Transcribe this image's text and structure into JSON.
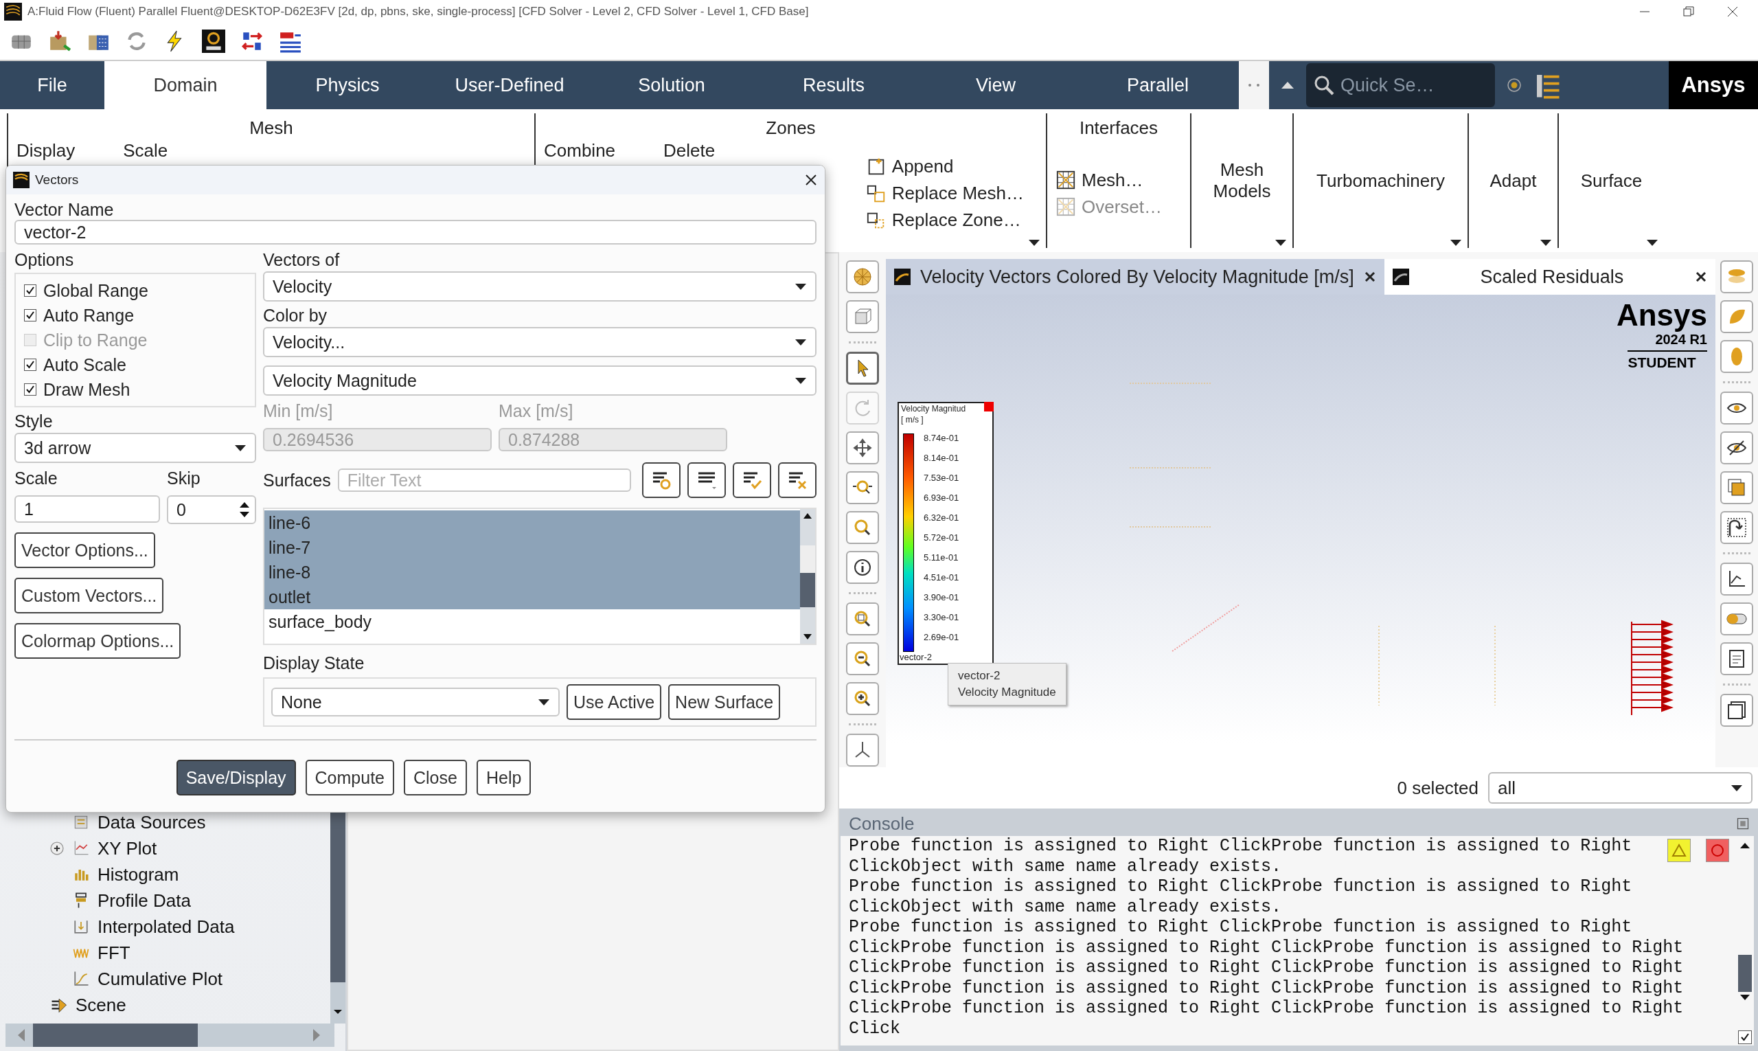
{
  "window": {
    "title": "A:Fluid Flow (Fluent) Parallel Fluent@DESKTOP-D62E3FV  [2d, dp, pbns, ske, single-process] [CFD Solver - Level 2, CFD Solver - Level 1, CFD Base]"
  },
  "menu_tabs": [
    {
      "label": "File",
      "selected": false
    },
    {
      "label": "Domain",
      "selected": true
    },
    {
      "label": "Physics",
      "selected": false
    },
    {
      "label": "User-Defined",
      "selected": false
    },
    {
      "label": "Solution",
      "selected": false
    },
    {
      "label": "Results",
      "selected": false
    },
    {
      "label": "View",
      "selected": false
    },
    {
      "label": "Parallel",
      "selected": false
    }
  ],
  "search": {
    "placeholder": "Quick Se…"
  },
  "brand": "Ansys",
  "ribbon": [
    {
      "kind": "buttons",
      "title": "Mesh",
      "buttons": [
        {
          "label": "Display"
        },
        {
          "label": "Scale"
        }
      ]
    },
    {
      "kind": "buttons",
      "title": "Zones",
      "has_menu": true,
      "buttons": [
        {
          "label": "Combine"
        },
        {
          "label": "Delete"
        }
      ],
      "column": [
        {
          "label": "Append",
          "disabled": false
        },
        {
          "label": "Replace Mesh…",
          "disabled": false
        },
        {
          "label": "Replace Zone…",
          "disabled": false
        }
      ]
    },
    {
      "kind": "buttons",
      "title": "Interfaces",
      "has_menu": false,
      "column": [
        {
          "label": "Mesh…",
          "disabled": false
        },
        {
          "label": "Overset…",
          "disabled": true
        }
      ]
    },
    {
      "kind": "menu",
      "title": "Mesh Models",
      "has_menu": true
    },
    {
      "kind": "menu",
      "title": "Turbomachinery",
      "has_menu": true
    },
    {
      "kind": "menu",
      "title": "Adapt",
      "has_menu": true
    },
    {
      "kind": "menu",
      "title": "Surface",
      "has_menu": true
    }
  ],
  "dialog": {
    "title": "Vectors",
    "vector_name": {
      "label": "Vector Name",
      "value": "vector-2"
    },
    "options": {
      "label": "Options",
      "items": [
        {
          "label": "Global Range",
          "checked": true,
          "disabled": false
        },
        {
          "label": "Auto Range",
          "checked": true,
          "disabled": false
        },
        {
          "label": "Clip to Range",
          "checked": false,
          "disabled": true
        },
        {
          "label": "Auto Scale",
          "checked": true,
          "disabled": false
        },
        {
          "label": "Draw Mesh",
          "checked": true,
          "disabled": false
        }
      ]
    },
    "style": {
      "label": "Style",
      "value": "3d arrow"
    },
    "scale": {
      "label": "Scale",
      "value": "1"
    },
    "skip": {
      "label": "Skip",
      "value": "0"
    },
    "side_buttons": [
      "Vector Options...",
      "Custom Vectors...",
      "Colormap Options..."
    ],
    "vectors_of": {
      "label": "Vectors of",
      "value": "Velocity"
    },
    "color_by": {
      "label": "Color by",
      "value": "Velocity...",
      "sub_value": "Velocity Magnitude"
    },
    "min": {
      "label": "Min [m/s]",
      "value": "0.2694536",
      "disabled": true
    },
    "max": {
      "label": "Max [m/s]",
      "value": "0.874288",
      "disabled": true
    },
    "surfaces": {
      "label": "Surfaces",
      "placeholder": "Filter Text",
      "items": [
        {
          "label": "line-6",
          "selected": true
        },
        {
          "label": "line-7",
          "selected": true
        },
        {
          "label": "line-8",
          "selected": true
        },
        {
          "label": "outlet",
          "selected": true
        },
        {
          "label": "surface_body",
          "selected": false
        }
      ]
    },
    "display_state": {
      "label": "Display State",
      "value": "None",
      "buttons": [
        "Use Active",
        "New Surface"
      ]
    },
    "actions": [
      {
        "label": "Save/Display",
        "primary": true
      },
      {
        "label": "Compute",
        "primary": false
      },
      {
        "label": "Close",
        "primary": false
      },
      {
        "label": "Help",
        "primary": false
      }
    ]
  },
  "tree": {
    "nested": [
      {
        "label": "Data Sources"
      },
      {
        "label": "XY Plot",
        "expanded": false
      },
      {
        "label": "Histogram"
      },
      {
        "label": "Profile Data"
      },
      {
        "label": "Interpolated Data"
      },
      {
        "label": "FFT"
      },
      {
        "label": "Cumulative Plot"
      }
    ],
    "items": [
      {
        "label": "Scene"
      }
    ]
  },
  "graphics": {
    "tabs": [
      {
        "title": "Velocity Vectors Colored By Velocity Magnitude [m/s]",
        "selected": true
      },
      {
        "title": "Scaled Residuals",
        "selected": false
      }
    ],
    "left_tools": [
      {
        "selected": false,
        "disabled": false
      },
      {
        "selected": false,
        "disabled": false
      },
      {
        "selected": true,
        "disabled": false
      },
      {
        "selected": false,
        "disabled": true
      },
      {
        "selected": false,
        "disabled": false
      },
      {
        "selected": false,
        "disabled": false
      },
      {
        "selected": false,
        "disabled": false
      },
      {
        "selected": false,
        "disabled": false
      },
      {
        "selected": false,
        "disabled": false
      },
      {
        "selected": false,
        "disabled": false
      },
      {
        "selected": false,
        "disabled": false
      },
      {
        "selected": false,
        "disabled": false
      }
    ],
    "logo": {
      "name": "Ansys",
      "version": "2024 R1",
      "edition": "STUDENT"
    },
    "legend": {
      "title": "Velocity Magnitud",
      "unit": "[ m/s ]",
      "values": [
        "8.74e-01",
        "8.14e-01",
        "7.53e-01",
        "6.93e-01",
        "6.32e-01",
        "5.72e-01",
        "5.11e-01",
        "4.51e-01",
        "3.90e-01",
        "3.30e-01",
        "2.69e-01"
      ],
      "footer": "vector-2"
    },
    "tooltip": [
      "vector-2",
      "Velocity Magnitude"
    ],
    "selection": {
      "count": "0 selected",
      "filter": "all"
    }
  },
  "console": {
    "title": "Console",
    "follow": {
      "checked": true
    },
    "lines": [
      "Probe function is assigned to Right ClickProbe function is assigned to Right",
      "ClickObject with same name already exists.",
      "Probe function is assigned to Right ClickProbe function is assigned to Right",
      "ClickObject with same name already exists.",
      "Probe function is assigned to Right ClickProbe function is assigned to Right",
      "ClickProbe function is assigned to Right ClickProbe function is assigned to Right",
      "ClickProbe function is assigned to Right ClickProbe function is assigned to Right",
      "ClickProbe function is assigned to Right ClickProbe function is assigned to Right",
      "ClickProbe function is assigned to Right ClickProbe function is assigned to Right",
      "Click"
    ]
  }
}
